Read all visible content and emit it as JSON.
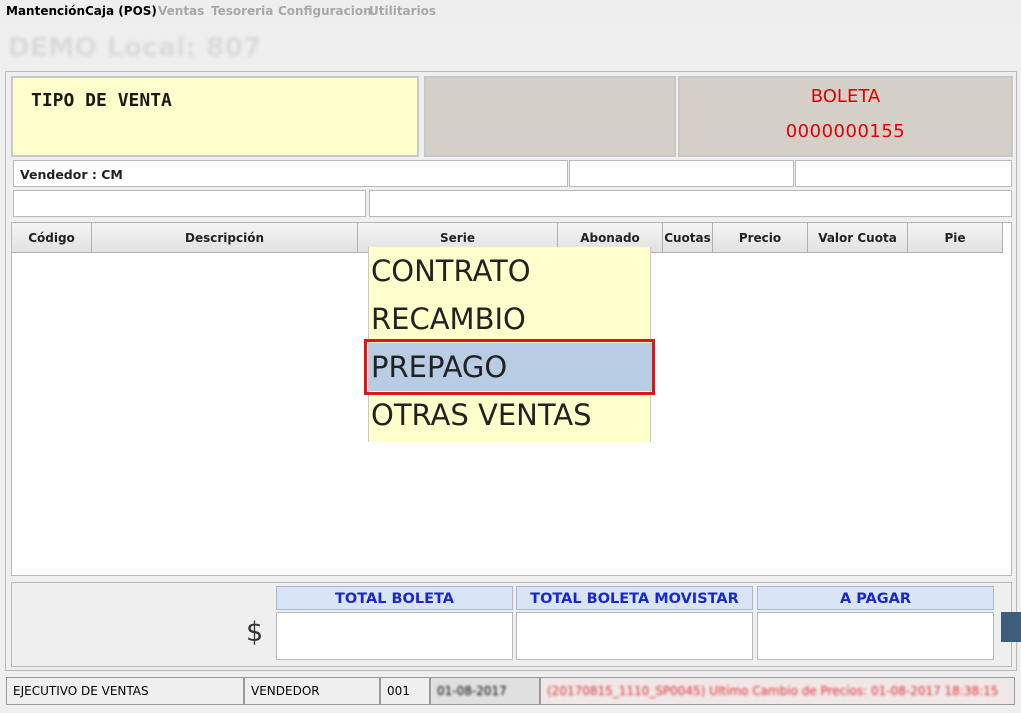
{
  "menu": [
    {
      "label": "Mantención",
      "enabled": true
    },
    {
      "label": "Caja (POS)",
      "enabled": true
    },
    {
      "label": "Ventas",
      "enabled": false
    },
    {
      "label": "Tesoreria",
      "enabled": false
    },
    {
      "label": "Configuracion",
      "enabled": false
    },
    {
      "label": "Utilitarios",
      "enabled": false
    }
  ],
  "header": {
    "store_title": "DEMO Local: 807"
  },
  "sale_type": {
    "label": "TIPO DE VENTA"
  },
  "document": {
    "type": "BOLETA",
    "number": "0000000155"
  },
  "vendor": {
    "label": "Vendedor : CM"
  },
  "table": {
    "columns": [
      "Código",
      "Descripción",
      "Serie",
      "Abonado",
      "Cuotas",
      "Precio",
      "Valor Cuota",
      "Pie"
    ]
  },
  "dropdown": {
    "options": [
      "CONTRATO",
      "RECAMBIO",
      "PREPAGO",
      "OTRAS VENTAS"
    ],
    "selected_index": 2
  },
  "totals": {
    "currency_symbol": "$",
    "headers": [
      "TOTAL BOLETA",
      "TOTAL BOLETA MOVISTAR",
      "A PAGAR"
    ]
  },
  "status_bar": {
    "role": "EJECUTIVO DE VENTAS",
    "user_type": "VENDEDOR",
    "code": "001",
    "date": "01-08-2017",
    "message": "(20170815_1110_SP0045) Ultimo Cambio de Precios: 01-08-2017 18:38:15"
  },
  "colors": {
    "accent_red": "#e00000",
    "total_header_text": "#1a28c8",
    "total_header_bg": "#d9e5f7",
    "panel_yellow": "#ffffcc",
    "selection_bg": "#b8cce4"
  }
}
